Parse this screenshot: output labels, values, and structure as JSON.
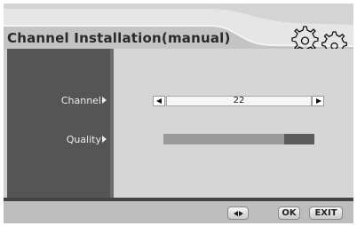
{
  "header": {
    "title": "Channel Installation(manual)",
    "icon": "gears-icon"
  },
  "fields": {
    "channel": {
      "label": "Channel",
      "value": "22"
    },
    "quality": {
      "label": "Quality",
      "level": 0.8
    }
  },
  "footer": {
    "nav_icon": "left-right-arrows-icon",
    "ok_label": "OK",
    "exit_label": "EXIT"
  },
  "colors": {
    "sidebar": "#555555",
    "content": "#d6d6d6",
    "quality_fill": "#9a9a9a",
    "quality_track": "#5c5c5c"
  }
}
